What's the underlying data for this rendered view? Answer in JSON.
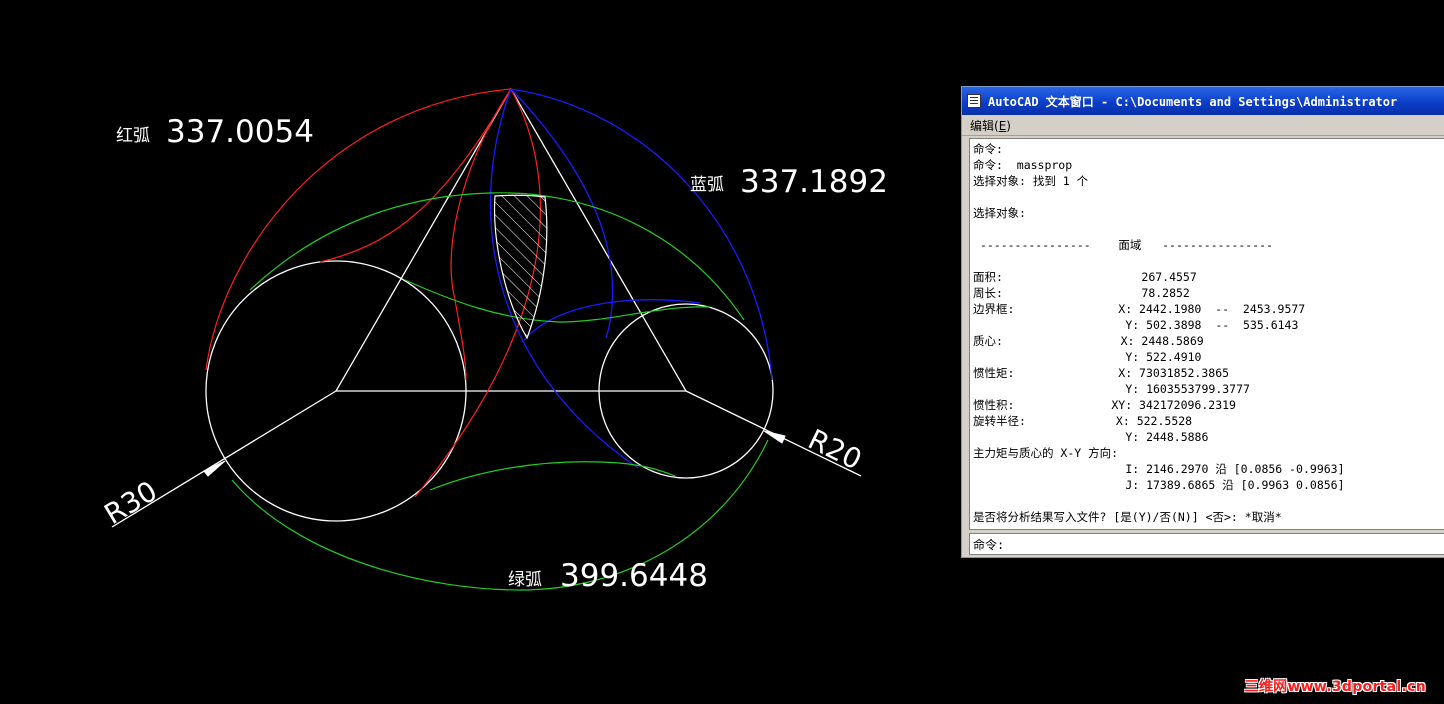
{
  "drawing": {
    "labels": {
      "red_arc_name": "红弧",
      "red_arc_value": "337.0054",
      "blue_arc_name": "蓝弧",
      "blue_arc_value": "337.1892",
      "green_arc_name": "绿弧",
      "green_arc_value": "399.6448",
      "radius_left": "R30",
      "radius_right": "R20"
    },
    "colors": {
      "background": "#000000",
      "white": "#ffffff",
      "red": "#ff2020",
      "blue": "#1a1aff",
      "green": "#22cc22"
    }
  },
  "text_window": {
    "title": "AutoCAD 文本窗口 - C:\\Documents and Settings\\Administrator",
    "menu": "编辑",
    "menu_accel": "E",
    "lines": [
      "命令:",
      "命令:  massprop",
      "选择对象: 找到 1 个",
      "",
      "选择对象:",
      "",
      " ----------------    面域   ----------------",
      "",
      "面积:                    267.4557",
      "周长:                    78.2852",
      "边界框:               X: 2442.1980  --  2453.9577",
      "                      Y: 502.3898  --  535.6143",
      "质心:                 X: 2448.5869",
      "                      Y: 522.4910",
      "惯性矩:               X: 73031852.3865",
      "                      Y: 1603553799.3777",
      "惯性积:              XY: 342172096.2319",
      "旋转半径:             X: 522.5528",
      "                      Y: 2448.5886",
      "主力矩与质心的 X-Y 方向:",
      "                      I: 2146.2970 沿 [0.0856 -0.9963]",
      "                      J: 17389.6865 沿 [0.9963 0.0856]",
      "",
      "是否将分析结果写入文件? [是(Y)/否(N)] <否>: *取消*"
    ],
    "command_prompt": "命令:"
  },
  "watermark": "三维网www.3dportal.cn"
}
